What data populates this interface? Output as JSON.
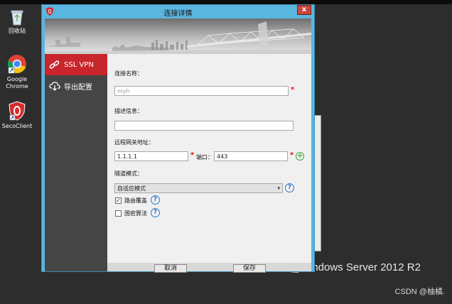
{
  "desktop": {
    "icons": [
      {
        "label": "回收站",
        "icon": "recycle-bin-icon"
      },
      {
        "label": "Google\nChrome",
        "icon": "chrome-icon"
      },
      {
        "label": "SecoClient",
        "icon": "secoclient-shield-icon"
      }
    ],
    "watermark": "indows Server 2012 R2",
    "credit": "CSDN @柚橘."
  },
  "dialog": {
    "title": "连接详情",
    "close_label": "x",
    "sidebar": {
      "items": [
        {
          "label": "SSL VPN",
          "icon": "link-icon",
          "active": true
        },
        {
          "label": "导出配置",
          "icon": "cloud-download-icon",
          "active": false
        }
      ]
    },
    "form": {
      "connection_name_label": "连接名称：",
      "connection_name_value": "myh",
      "description_label": "描述信息：",
      "description_value": "",
      "gateway_label": "远程网关地址：",
      "gateway_value": "1.1.1.1",
      "port_label": "端口：",
      "port_value": "443",
      "tunnel_label": "隧道模式：",
      "tunnel_value": "自适应模式",
      "route_cover_label": "路由覆盖",
      "route_cover_checked": true,
      "national_algo_label": "国密算法",
      "national_algo_checked": false,
      "required_mark": "*",
      "help_mark": "?",
      "add_mark": "+"
    },
    "buttons": {
      "cancel": "取消",
      "save": "保存"
    },
    "colors": {
      "accent": "#c8252c",
      "frame": "#5bb6df",
      "sidebar": "#454545"
    }
  }
}
